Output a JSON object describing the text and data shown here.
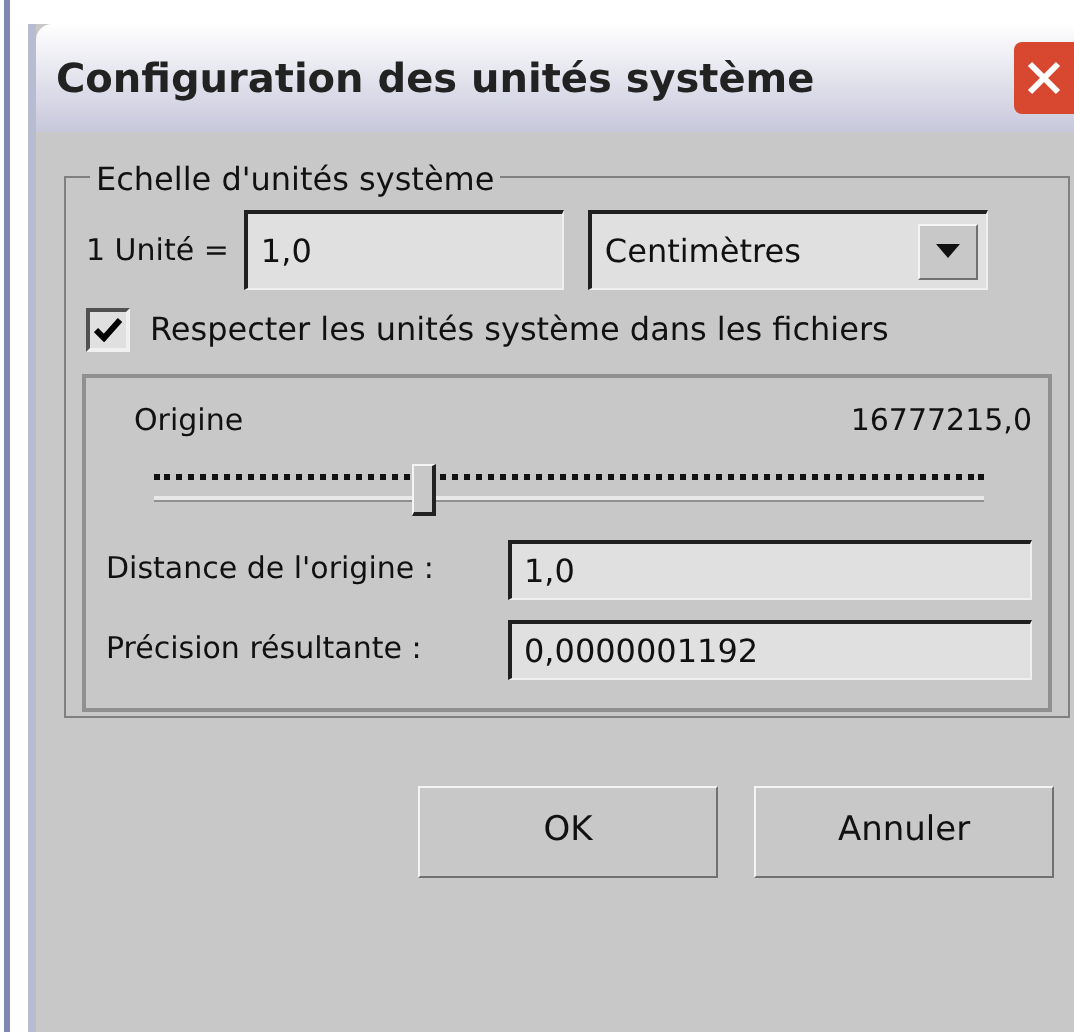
{
  "window": {
    "title": "Configuration des unités système"
  },
  "group": {
    "legend": "Echelle d'unités système",
    "unit_label": "1 Unité =",
    "unit_value": "1,0",
    "unit_select": "Centimètres",
    "respect_checkbox": {
      "label": "Respecter les unités système dans les fichiers",
      "checked": true
    }
  },
  "origin": {
    "label": "Origine",
    "reading": "16777215,0",
    "level": 0.325,
    "fields": [
      {
        "label": "Distance de l'origine :",
        "value": "1,0"
      },
      {
        "label": "Précision résultante :",
        "value": "0,0000001192"
      }
    ]
  },
  "buttons": [
    "OK",
    "Annuler"
  ]
}
